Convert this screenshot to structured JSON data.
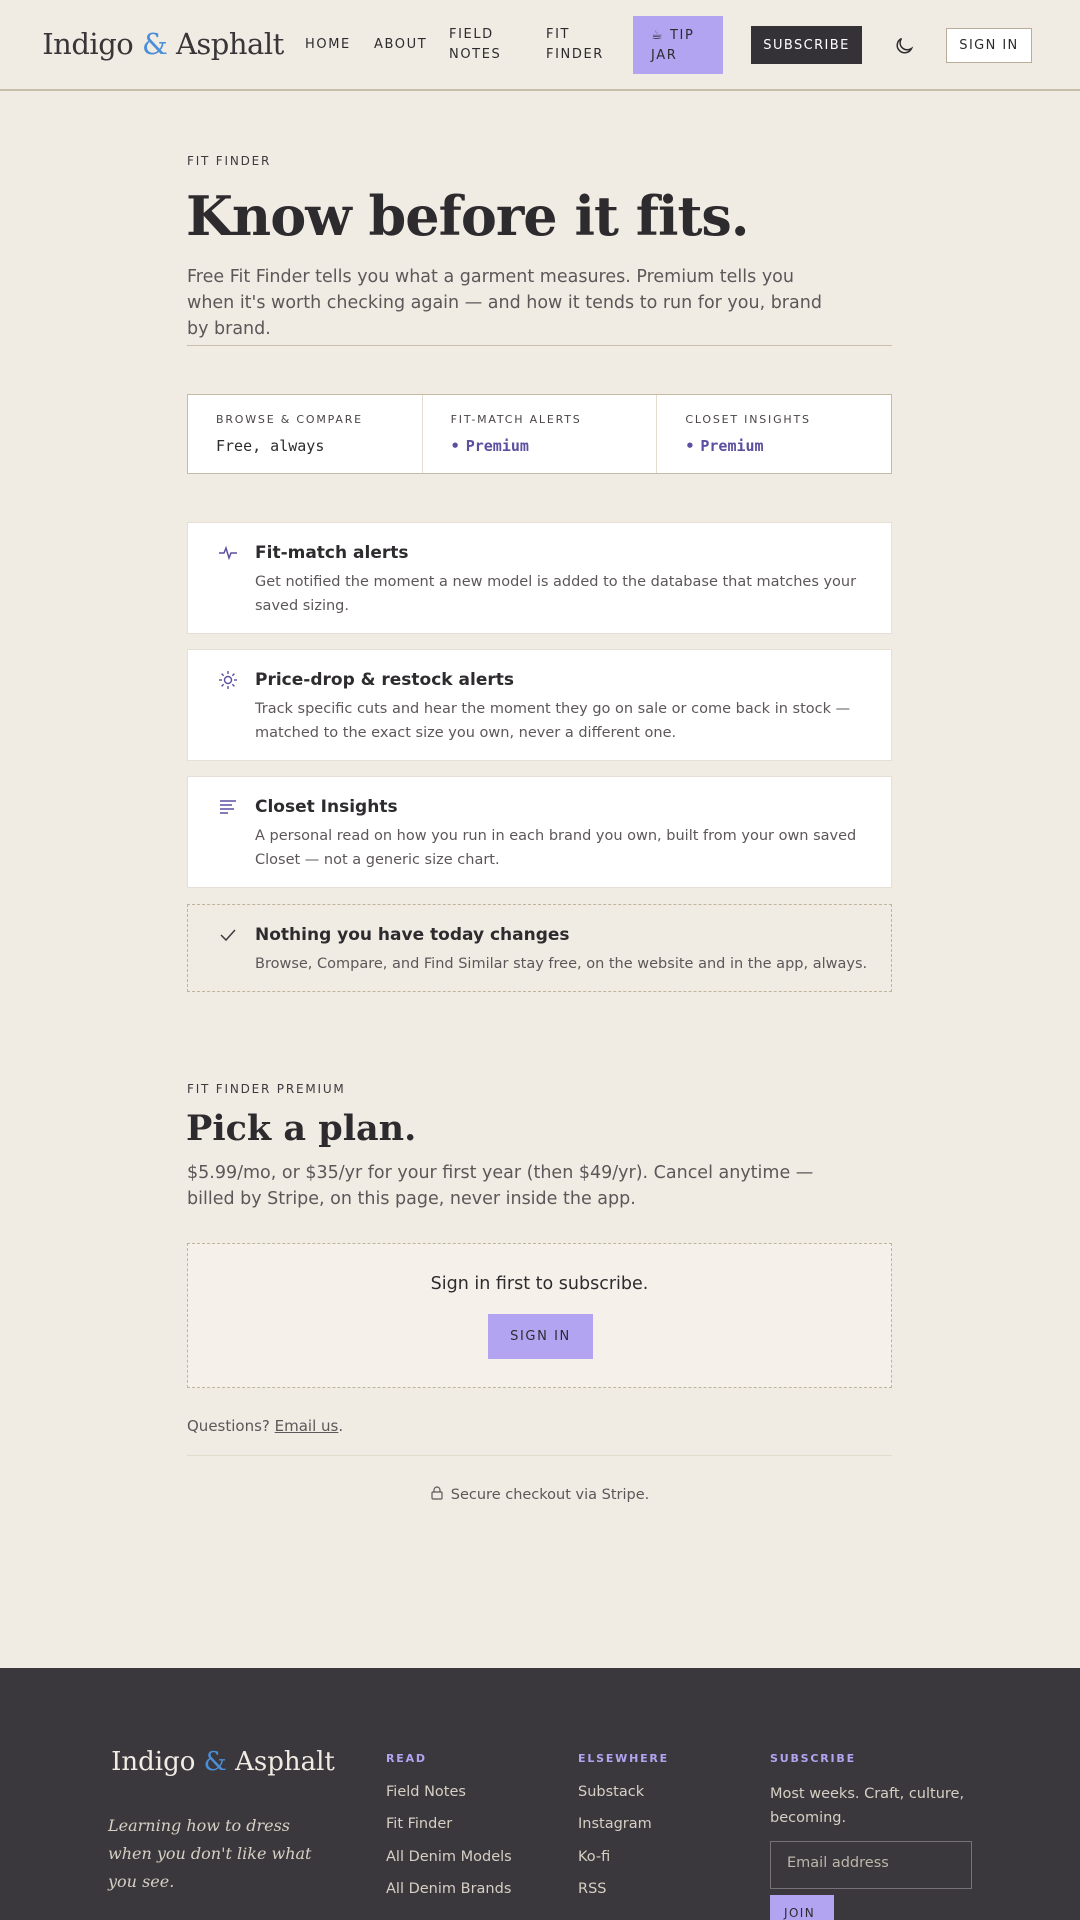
{
  "header": {
    "logo_left": "Indigo ",
    "logo_amp": "&",
    "logo_right": " Asphalt",
    "nav": {
      "home": "HOME",
      "about": "ABOUT",
      "field_notes_1": "FIELD",
      "field_notes_2": "NOTES",
      "fit_finder_1": "FIT",
      "fit_finder_2": "FINDER"
    },
    "tip_jar_1": "☕ TIP",
    "tip_jar_2": "JAR",
    "subscribe": "SUBSCRIBE",
    "sign_in": "SIGN IN"
  },
  "hero": {
    "eyebrow": "FIT FINDER",
    "title": "Know before it fits.",
    "subtitle": "Free Fit Finder tells you what a garment measures. Premium tells you when it's worth checking again — and how it tends to run for you, brand by brand."
  },
  "tiers": [
    {
      "label": "BROWSE & COMPARE",
      "value": "Free, always"
    },
    {
      "label": "FIT-MATCH ALERTS",
      "value": "Premium"
    },
    {
      "label": "CLOSET INSIGHTS",
      "value": "Premium"
    }
  ],
  "features": [
    {
      "icon": "pulse-icon",
      "title": "Fit-match alerts",
      "body": "Get notified the moment a new model is added to the database that matches your saved sizing."
    },
    {
      "icon": "sun-icon",
      "title": "Price-drop & restock alerts",
      "body": "Track specific cuts and hear the moment they go on sale or come back in stock — matched to the exact size you own, never a different one."
    },
    {
      "icon": "list-icon",
      "title": "Closet Insights",
      "body": "A personal read on how you run in each brand you own, built from your own saved Closet — not a generic size chart."
    },
    {
      "icon": "check-icon",
      "title": "Nothing you have today changes",
      "body": "Browse, Compare, and Find Similar stay free, on the website and in the app, always."
    }
  ],
  "plan": {
    "eyebrow": "FIT FINDER PREMIUM",
    "title": "Pick a plan.",
    "subtitle": "$5.99/mo, or $35/yr for your first year (then $49/yr). Cancel anytime — billed by Stripe, on this page, never inside the app.",
    "signin_msg": "Sign in first to subscribe.",
    "signin_btn": "SIGN IN",
    "questions_prefix": "Questions? ",
    "questions_link": "Email us",
    "questions_suffix": ".",
    "secure": "Secure checkout via Stripe."
  },
  "footer": {
    "logo_left": "Indigo ",
    "logo_amp": "&",
    "logo_right": " Asphalt",
    "tagline": "Learning how to dress when you don't like what you see.",
    "read": {
      "title": "READ",
      "links": [
        "Field Notes",
        "Fit Finder",
        "All Denim Models",
        "All Denim Brands"
      ]
    },
    "elsewhere": {
      "title": "ELSEWHERE",
      "links": [
        "Substack",
        "Instagram",
        "Ko-fi",
        "RSS"
      ]
    },
    "subscribe": {
      "title": "SUBSCRIBE",
      "text": "Most weeks. Craft, culture, becoming.",
      "placeholder": "Email address",
      "join": "JOIN"
    }
  },
  "colors": {
    "background": "#f0ebe3",
    "accent_lavender": "#b3a4f2",
    "premium_text": "#5c4fa0",
    "ampersand_blue": "#4a8fd8",
    "footer_bg": "#3a383d",
    "dark_button": "#343236"
  }
}
